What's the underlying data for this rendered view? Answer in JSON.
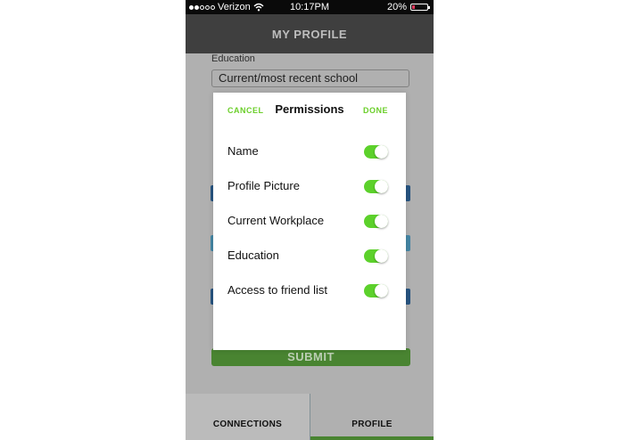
{
  "status_bar": {
    "carrier": "Verizon",
    "time": "10:17PM",
    "battery_percent": "20%",
    "battery_level": 0.2,
    "battery_color": "#e23a5e",
    "signal_icon": "signal-dots-icon",
    "wifi_icon": "wifi-icon"
  },
  "header": {
    "title": "MY PROFILE"
  },
  "form": {
    "education_label": "Education",
    "education_value": "Current/most recent school",
    "submit_label": "SUBMIT"
  },
  "tabs": [
    {
      "label": "CONNECTIONS",
      "active": false
    },
    {
      "label": "PROFILE",
      "active": true
    }
  ],
  "modal": {
    "title": "Permissions",
    "cancel_label": "CANCEL",
    "done_label": "DONE",
    "accent_color": "#6bcf2a",
    "permissions": [
      {
        "label": "Name",
        "enabled": true
      },
      {
        "label": "Profile Picture",
        "enabled": true
      },
      {
        "label": "Current Workplace",
        "enabled": true
      },
      {
        "label": "Education",
        "enabled": true
      },
      {
        "label": "Access to friend list",
        "enabled": true
      }
    ]
  }
}
